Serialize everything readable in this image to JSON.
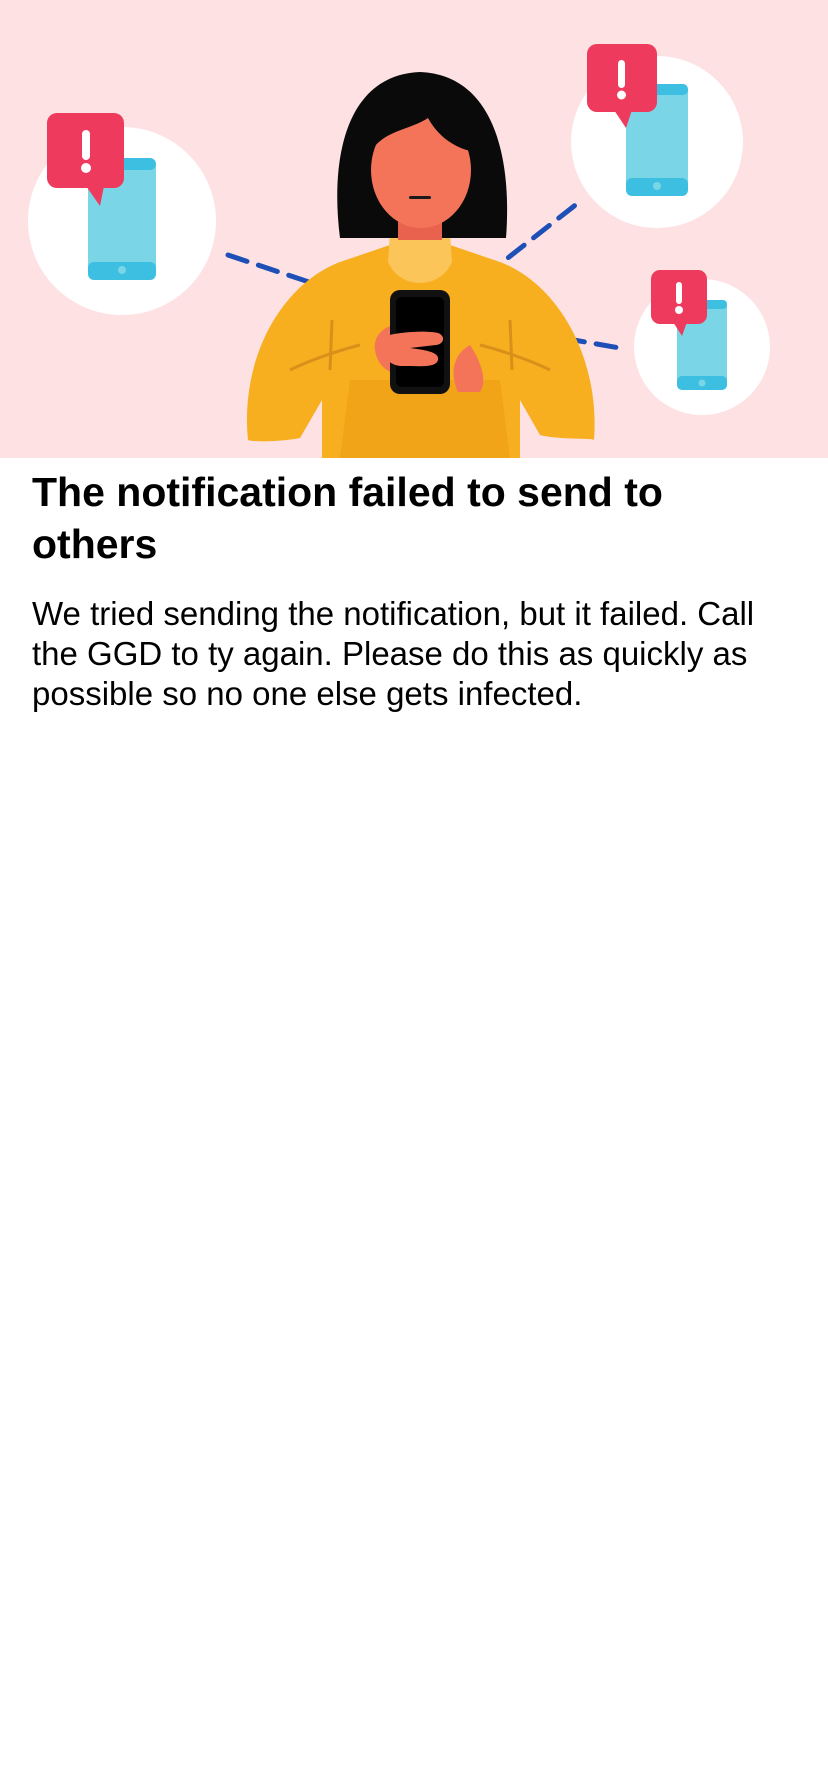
{
  "screen": {
    "title": "The notification failed to send to others",
    "body": "We tried sending the notification, but it failed. Call the GGD to ty again. Please do this as quickly as possible so no one else gets infected."
  },
  "illustration": {
    "background_color": "#fde1e3",
    "figure": "person-with-phone",
    "alerts": [
      "exclamation-icon",
      "exclamation-icon",
      "exclamation-icon"
    ],
    "accent_red": "#ee3a5c",
    "phone_blue": "#7ad5e6",
    "line_blue": "#1e4fb6",
    "sweater_yellow": "#f7ae1f"
  }
}
